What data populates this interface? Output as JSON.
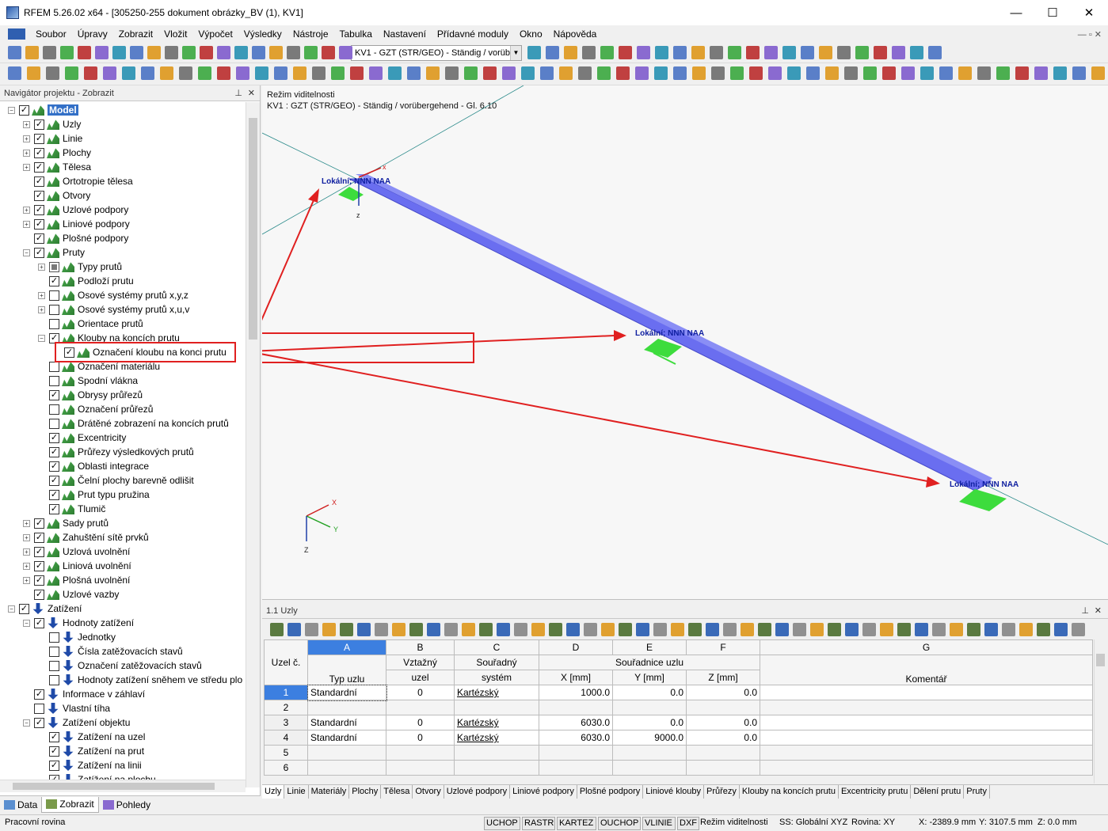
{
  "window": {
    "title": "RFEM 5.26.02 x64 - [305250-255 dokument obrázky_BV (1), KV1]",
    "minimize": "—",
    "maximize": "☐",
    "close": "✕"
  },
  "menu": [
    "Soubor",
    "Úpravy",
    "Zobrazit",
    "Vložit",
    "Výpočet",
    "Výsledky",
    "Nástroje",
    "Tabulka",
    "Nastavení",
    "Přídavné moduly",
    "Okno",
    "Nápověda"
  ],
  "toolbar": {
    "loadcase": "KV1 - GZT (STR/GEO) - Ständig / vorübe"
  },
  "navigator": {
    "title": "Navigátor projektu - Zobrazit",
    "items": [
      {
        "label": "Model",
        "level": 0,
        "exp": "−",
        "check": "✓",
        "icon": "model",
        "selected": true
      },
      {
        "label": "Uzly",
        "level": 1,
        "exp": "+",
        "check": "✓",
        "icon": "model"
      },
      {
        "label": "Linie",
        "level": 1,
        "exp": "+",
        "check": "✓",
        "icon": "model"
      },
      {
        "label": "Plochy",
        "level": 1,
        "exp": "+",
        "check": "✓",
        "icon": "model"
      },
      {
        "label": "Tělesa",
        "level": 1,
        "exp": "+",
        "check": "✓",
        "icon": "model"
      },
      {
        "label": "Ortotropie tělesa",
        "level": 1,
        "exp": "",
        "check": "✓",
        "icon": "model"
      },
      {
        "label": "Otvory",
        "level": 1,
        "exp": "",
        "check": "✓",
        "icon": "model"
      },
      {
        "label": "Uzlové podpory",
        "level": 1,
        "exp": "+",
        "check": "✓",
        "icon": "model"
      },
      {
        "label": "Liniové podpory",
        "level": 1,
        "exp": "+",
        "check": "✓",
        "icon": "model"
      },
      {
        "label": "Plošné podpory",
        "level": 1,
        "exp": "",
        "check": "✓",
        "icon": "model"
      },
      {
        "label": "Pruty",
        "level": 1,
        "exp": "−",
        "check": "✓",
        "icon": "model"
      },
      {
        "label": "Typy prutů",
        "level": 2,
        "exp": "+",
        "check": "part",
        "icon": "model"
      },
      {
        "label": "Podloží prutu",
        "level": 2,
        "exp": "",
        "check": "✓",
        "icon": "model"
      },
      {
        "label": "Osové systémy prutů x,y,z",
        "level": 2,
        "exp": "+",
        "check": "",
        "icon": "model"
      },
      {
        "label": "Osové systémy prutů x,u,v",
        "level": 2,
        "exp": "+",
        "check": "",
        "icon": "model"
      },
      {
        "label": "Orientace prutů",
        "level": 2,
        "exp": "",
        "check": "",
        "icon": "model"
      },
      {
        "label": "Klouby na koncích prutu",
        "level": 2,
        "exp": "−",
        "check": "✓",
        "icon": "model"
      },
      {
        "label": "Označení kloubu na konci prutu",
        "level": 3,
        "exp": "",
        "check": "✓",
        "icon": "model",
        "highlight": true
      },
      {
        "label": "Označení materiálu",
        "level": 2,
        "exp": "",
        "check": "",
        "icon": "model"
      },
      {
        "label": "Spodní vlákna",
        "level": 2,
        "exp": "",
        "check": "",
        "icon": "model"
      },
      {
        "label": "Obrysy průřezů",
        "level": 2,
        "exp": "",
        "check": "✓",
        "icon": "model"
      },
      {
        "label": "Označení průřezů",
        "level": 2,
        "exp": "",
        "check": "",
        "icon": "model"
      },
      {
        "label": "Drátěné zobrazení na koncích prutů",
        "level": 2,
        "exp": "",
        "check": "",
        "icon": "model"
      },
      {
        "label": "Excentricity",
        "level": 2,
        "exp": "",
        "check": "✓",
        "icon": "model"
      },
      {
        "label": "Průřezy výsledkových prutů",
        "level": 2,
        "exp": "",
        "check": "✓",
        "icon": "model"
      },
      {
        "label": "Oblasti integrace",
        "level": 2,
        "exp": "",
        "check": "✓",
        "icon": "model"
      },
      {
        "label": "Čelní plochy barevně odlišit",
        "level": 2,
        "exp": "",
        "check": "✓",
        "icon": "model"
      },
      {
        "label": "Prut typu pružina",
        "level": 2,
        "exp": "",
        "check": "✓",
        "icon": "model"
      },
      {
        "label": "Tlumič",
        "level": 2,
        "exp": "",
        "check": "✓",
        "icon": "model"
      },
      {
        "label": "Sady prutů",
        "level": 1,
        "exp": "+",
        "check": "✓",
        "icon": "model"
      },
      {
        "label": "Zahuštění sítě prvků",
        "level": 1,
        "exp": "+",
        "check": "✓",
        "icon": "model"
      },
      {
        "label": "Uzlová uvolnění",
        "level": 1,
        "exp": "+",
        "check": "✓",
        "icon": "model"
      },
      {
        "label": "Liniová uvolnění",
        "level": 1,
        "exp": "+",
        "check": "✓",
        "icon": "model"
      },
      {
        "label": "Plošná uvolnění",
        "level": 1,
        "exp": "+",
        "check": "✓",
        "icon": "model"
      },
      {
        "label": "Uzlové vazby",
        "level": 1,
        "exp": "",
        "check": "✓",
        "icon": "model"
      },
      {
        "label": "Zatížení",
        "level": 0,
        "exp": "−",
        "check": "✓",
        "icon": "load"
      },
      {
        "label": "Hodnoty zatížení",
        "level": 1,
        "exp": "−",
        "check": "✓",
        "icon": "load"
      },
      {
        "label": "Jednotky",
        "level": 2,
        "exp": "",
        "check": "",
        "icon": "load"
      },
      {
        "label": "Čísla zatěžovacích stavů",
        "level": 2,
        "exp": "",
        "check": "",
        "icon": "load"
      },
      {
        "label": "Označení zatěžovacích stavů",
        "level": 2,
        "exp": "",
        "check": "",
        "icon": "load"
      },
      {
        "label": "Hodnoty zatížení sněhem ve středu plo",
        "level": 2,
        "exp": "",
        "check": "",
        "icon": "load"
      },
      {
        "label": "Informace v záhlaví",
        "level": 1,
        "exp": "",
        "check": "✓",
        "icon": "load"
      },
      {
        "label": "Vlastní tíha",
        "level": 1,
        "exp": "",
        "check": "",
        "icon": "load"
      },
      {
        "label": "Zatížení objektu",
        "level": 1,
        "exp": "−",
        "check": "✓",
        "icon": "load"
      },
      {
        "label": "Zatížení na uzel",
        "level": 2,
        "exp": "",
        "check": "✓",
        "icon": "load"
      },
      {
        "label": "Zatížení na prut",
        "level": 2,
        "exp": "",
        "check": "✓",
        "icon": "load"
      },
      {
        "label": "Zatížení na linii",
        "level": 2,
        "exp": "",
        "check": "✓",
        "icon": "load"
      },
      {
        "label": "Zatížení na plochu",
        "level": 2,
        "exp": "",
        "check": "✓",
        "icon": "load"
      }
    ],
    "tabs": [
      "Data",
      "Zobrazit",
      "Pohledy"
    ]
  },
  "viewport": {
    "mode": "Režim viditelnosti",
    "loadcase": "KV1 : GZT (STR/GEO) - Ständig / vorübergehend - Gl. 6.10",
    "hinge_label": "Lokální; NNN NAA",
    "axis_x": "X",
    "axis_y": "Y",
    "axis_z": "Z",
    "node_axis_x": "x",
    "node_axis_z": "z"
  },
  "table": {
    "title": "1.1 Uzly",
    "col_letters": [
      "A",
      "B",
      "C",
      "D",
      "E",
      "F",
      "G"
    ],
    "head_uzel": "Uzel č.",
    "head_vztazny": "Vztažný",
    "head_souradny": "Souřadný",
    "head_souradnice": "Souřadnice uzlu",
    "head_typ": "Typ uzlu",
    "head_uzel2": "uzel",
    "head_system": "systém",
    "head_x": "X [mm]",
    "head_y": "Y [mm]",
    "head_z": "Z [mm]",
    "head_koment": "Komentář",
    "rows": [
      {
        "no": "1",
        "typ": "Standardní",
        "ref": "0",
        "sys": "Kartézský",
        "x": "1000.0",
        "y": "0.0",
        "z": "0.0"
      },
      {
        "no": "2",
        "typ": "",
        "ref": "",
        "sys": "",
        "x": "",
        "y": "",
        "z": ""
      },
      {
        "no": "3",
        "typ": "Standardní",
        "ref": "0",
        "sys": "Kartézský",
        "x": "6030.0",
        "y": "0.0",
        "z": "0.0"
      },
      {
        "no": "4",
        "typ": "Standardní",
        "ref": "0",
        "sys": "Kartézský",
        "x": "6030.0",
        "y": "9000.0",
        "z": "0.0"
      },
      {
        "no": "5",
        "typ": "",
        "ref": "",
        "sys": "",
        "x": "",
        "y": "",
        "z": ""
      },
      {
        "no": "6",
        "typ": "",
        "ref": "",
        "sys": "",
        "x": "",
        "y": "",
        "z": ""
      }
    ],
    "tabs": [
      "Uzly",
      "Linie",
      "Materiály",
      "Plochy",
      "Tělesa",
      "Otvory",
      "Uzlové podpory",
      "Liniové podpory",
      "Plošné podpory",
      "Liniové klouby",
      "Průřezy",
      "Klouby na koncích prutu",
      "Excentricity prutu",
      "Dělení prutu",
      "Pruty"
    ]
  },
  "status": {
    "left": "Pracovní rovina",
    "toggles": [
      "UCHOP",
      "RASTR",
      "KARTEZ",
      "OUCHOP",
      "VLINIE",
      "DXF"
    ],
    "mode": "Režim viditelnosti",
    "ss": "SS: Globální XYZ",
    "plane": "Rovina: XY",
    "x": "X: -2389.9 mm",
    "y": "Y: 3107.5 mm",
    "z": "Z: 0.0 mm"
  },
  "colors": {
    "accent": "#3c7fe0",
    "member": "#6a6ef0",
    "support": "#3ddc3d",
    "callout": "#e02020"
  }
}
